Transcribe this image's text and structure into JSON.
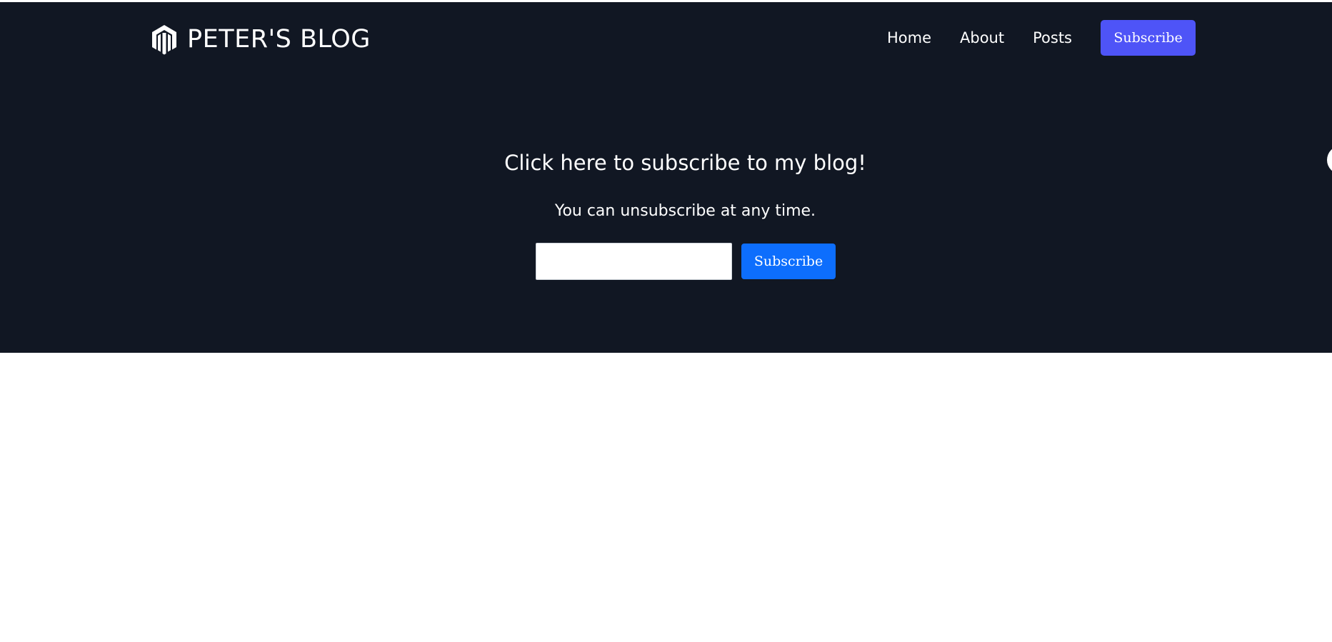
{
  "header": {
    "brand_name": "PETER'S BLOG",
    "logo_icon": "magento-hexagon-icon",
    "nav": [
      {
        "label": "Home"
      },
      {
        "label": "About"
      },
      {
        "label": "Posts"
      }
    ],
    "subscribe_label": "Subscribe"
  },
  "hero": {
    "title": "Click here to subscribe to my blog!",
    "subtitle": "You can unsubscribe at any time.",
    "email_input": {
      "value": "",
      "placeholder": ""
    },
    "subscribe_label": "Subscribe"
  },
  "colors": {
    "hero_background": "#111723",
    "nav_subscribe": "#4e54f7",
    "form_subscribe": "#0d6efd",
    "page_background": "#ffffff"
  }
}
